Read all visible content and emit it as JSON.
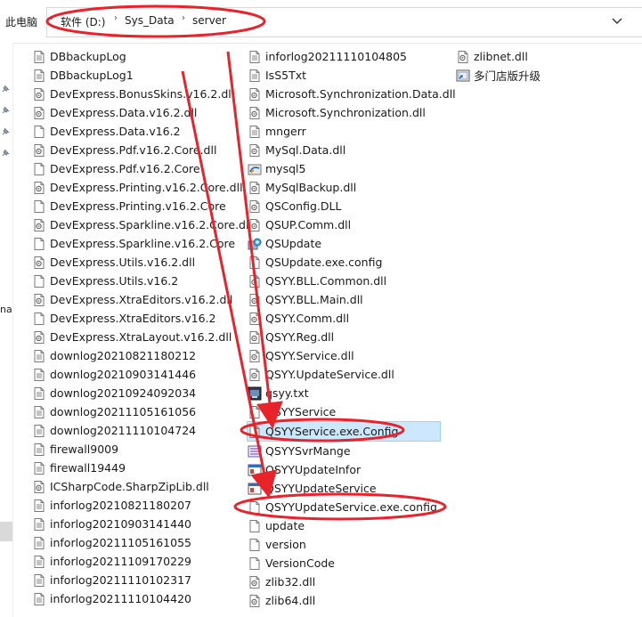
{
  "breadcrumb": {
    "root": "此电脑",
    "drive": "软件 (D:)",
    "folder1": "Sys_Data",
    "folder2": "server"
  },
  "nav": {
    "fragment": "na"
  },
  "columns": [
    [
      {
        "name": "DBbackupLog",
        "icon": "text-file-icon"
      },
      {
        "name": "DBbackupLog1",
        "icon": "text-file-icon"
      },
      {
        "name": "DevExpress.BonusSkins.v16.2.dll",
        "icon": "dll-file-icon"
      },
      {
        "name": "DevExpress.Data.v16.2.dll",
        "icon": "dll-file-icon"
      },
      {
        "name": "DevExpress.Data.v16.2",
        "icon": "blank-file-icon"
      },
      {
        "name": "DevExpress.Pdf.v16.2.Core.dll",
        "icon": "dll-file-icon"
      },
      {
        "name": "DevExpress.Pdf.v16.2.Core",
        "icon": "blank-file-icon"
      },
      {
        "name": "DevExpress.Printing.v16.2.Core.dll",
        "icon": "dll-file-icon"
      },
      {
        "name": "DevExpress.Printing.v16.2.Core",
        "icon": "blank-file-icon"
      },
      {
        "name": "DevExpress.Sparkline.v16.2.Core.dll",
        "icon": "dll-file-icon"
      },
      {
        "name": "DevExpress.Sparkline.v16.2.Core",
        "icon": "blank-file-icon"
      },
      {
        "name": "DevExpress.Utils.v16.2.dll",
        "icon": "dll-file-icon"
      },
      {
        "name": "DevExpress.Utils.v16.2",
        "icon": "blank-file-icon"
      },
      {
        "name": "DevExpress.XtraEditors.v16.2.dll",
        "icon": "dll-file-icon"
      },
      {
        "name": "DevExpress.XtraEditors.v16.2",
        "icon": "blank-file-icon"
      },
      {
        "name": "DevExpress.XtraLayout.v16.2.dll",
        "icon": "dll-file-icon"
      },
      {
        "name": "downlog20210821180212",
        "icon": "text-file-icon"
      },
      {
        "name": "downlog20210903141446",
        "icon": "text-file-icon"
      },
      {
        "name": "downlog20210924092034",
        "icon": "text-file-icon"
      },
      {
        "name": "downlog20211105161056",
        "icon": "text-file-icon"
      },
      {
        "name": "downlog20211110104724",
        "icon": "text-file-icon"
      },
      {
        "name": "firewall9009",
        "icon": "text-file-icon"
      },
      {
        "name": "firewall19449",
        "icon": "text-file-icon"
      },
      {
        "name": "ICSharpCode.SharpZipLib.dll",
        "icon": "dll-file-icon"
      },
      {
        "name": "inforlog20210821180207",
        "icon": "text-file-icon"
      },
      {
        "name": "inforlog20210903141440",
        "icon": "text-file-icon"
      },
      {
        "name": "inforlog20211105161055",
        "icon": "text-file-icon"
      },
      {
        "name": "inforlog20211109170229",
        "icon": "text-file-icon"
      },
      {
        "name": "inforlog20211110102317",
        "icon": "text-file-icon"
      },
      {
        "name": "inforlog20211110104420",
        "icon": "text-file-icon"
      }
    ],
    [
      {
        "name": "inforlog20211110104805",
        "icon": "text-file-icon"
      },
      {
        "name": "IsS5Txt",
        "icon": "text-file-icon"
      },
      {
        "name": "Microsoft.Synchronization.Data.dll",
        "icon": "dll-file-icon"
      },
      {
        "name": "Microsoft.Synchronization.dll",
        "icon": "dll-file-icon"
      },
      {
        "name": "mngerr",
        "icon": "text-file-icon"
      },
      {
        "name": "MySql.Data.dll",
        "icon": "dll-file-icon"
      },
      {
        "name": "mysql5",
        "icon": "mysql-icon"
      },
      {
        "name": "MySqlBackup.dll",
        "icon": "dll-file-icon"
      },
      {
        "name": "QSConfig.DLL",
        "icon": "dll-file-icon"
      },
      {
        "name": "QSUP.Comm.dll",
        "icon": "dll-file-icon"
      },
      {
        "name": "QSUpdate",
        "icon": "app-update-icon"
      },
      {
        "name": "QSUpdate.exe.config",
        "icon": "blank-file-icon"
      },
      {
        "name": "QSYY.BLL.Common.dll",
        "icon": "dll-file-icon"
      },
      {
        "name": "QSYY.BLL.Main.dll",
        "icon": "dll-file-icon"
      },
      {
        "name": "QSYY.Comm.dll",
        "icon": "dll-file-icon"
      },
      {
        "name": "QSYY.Reg.dll",
        "icon": "dll-file-icon"
      },
      {
        "name": "QSYY.Service.dll",
        "icon": "dll-file-icon"
      },
      {
        "name": "QSYY.UpdateService.dll",
        "icon": "dll-file-icon"
      },
      {
        "name": "qsyy.txt",
        "icon": "app-qsyy-icon"
      },
      {
        "name": "QSYYService",
        "icon": "blank-file-icon"
      },
      {
        "name": "QSYYService.exe.Config",
        "icon": "blank-file-icon",
        "selected": true
      },
      {
        "name": "QSYYSvrMange",
        "icon": "app-manage-icon"
      },
      {
        "name": "QSYYUpdateInfor",
        "icon": "app-window-icon"
      },
      {
        "name": "QSYYUpdateService",
        "icon": "app-window-icon"
      },
      {
        "name": "QSYYUpdateService.exe.config",
        "icon": "blank-file-icon"
      },
      {
        "name": "update",
        "icon": "blank-file-icon"
      },
      {
        "name": "version",
        "icon": "blank-file-icon"
      },
      {
        "name": "VersionCode",
        "icon": "blank-file-icon"
      },
      {
        "name": "zlib32.dll",
        "icon": "dll-file-icon"
      },
      {
        "name": "zlib64.dll",
        "icon": "dll-file-icon"
      }
    ],
    [
      {
        "name": "zlibnet.dll",
        "icon": "dll-file-icon"
      },
      {
        "name": "多门店版升级",
        "icon": "shortcut-icon"
      }
    ]
  ],
  "colors": {
    "annotation": "#e8232a",
    "selection_bg": "#cce8ff",
    "selection_border": "#99d1ff"
  }
}
